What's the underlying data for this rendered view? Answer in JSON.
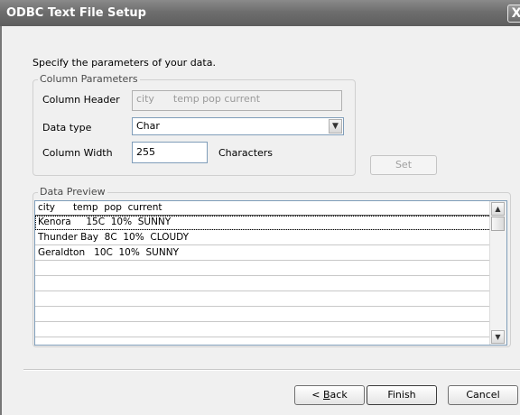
{
  "window": {
    "title": "ODBC Text File Setup",
    "close_glyph": "X"
  },
  "intro": "Specify the parameters of your data.",
  "column_parameters": {
    "legend": "Column Parameters",
    "header_label": "Column Header",
    "header_value": "city      temp pop current",
    "datatype_label": "Data type",
    "datatype_value": "Char",
    "width_label": "Column Width",
    "width_value": "255",
    "width_unit": "Characters",
    "set_button": "Set"
  },
  "preview": {
    "legend": "Data Preview",
    "header_row": "city      temp  pop  current",
    "rows": [
      "Kenora     15C  10%  SUNNY",
      "Thunder Bay  8C  10%  CLOUDY",
      "Geraldton   10C  10%  SUNNY"
    ]
  },
  "buttons": {
    "back_prefix": "< ",
    "back_mnemonic": "B",
    "back_rest": "ack",
    "finish": "Finish",
    "cancel": "Cancel"
  },
  "icons": {
    "dropdown": "chevron-down-icon",
    "scroll_up": "arrow-up-icon",
    "scroll_down": "arrow-down-icon"
  }
}
